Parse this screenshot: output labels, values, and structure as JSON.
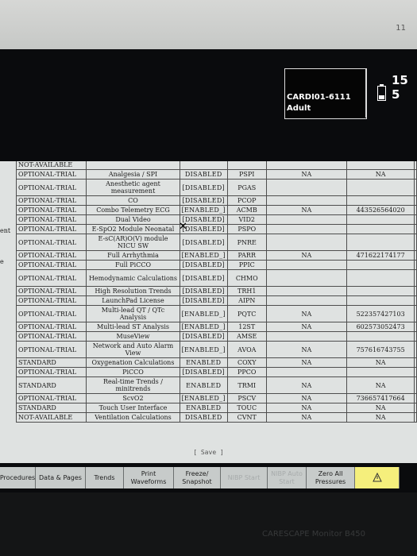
{
  "corner_label": "11",
  "patient": {
    "id": "CARDI01-6111",
    "type": "Adult"
  },
  "status_value": "15 5",
  "leftcut": {
    "a": "ent",
    "b": "e"
  },
  "rows": [
    {
      "option": "OPTIONAL-TRIAL",
      "feature": "Analgesia / SPI",
      "state": "DISABLED",
      "code": "PSPI",
      "c5": "NA",
      "c6": "NA"
    },
    {
      "option": "OPTIONAL-TRIAL",
      "feature": "Anesthetic agent measurement",
      "state": "[DISABLED]",
      "code": "PGAS",
      "c5": "",
      "c6": ""
    },
    {
      "option": "OPTIONAL-TRIAL",
      "feature": "CO",
      "state": "[DISABLED]",
      "code": "PCOP",
      "c5": "",
      "c6": ""
    },
    {
      "option": "OPTIONAL-TRIAL",
      "feature": "Combo Telemetry ECG",
      "state": "[ENABLED_]",
      "code": "ACMB",
      "c5": "NA",
      "c6": "443526564020"
    },
    {
      "option": "OPTIONAL-TRIAL",
      "feature": "Dual Video",
      "state": "[DISABLED]",
      "code": "VID2",
      "c5": "",
      "c6": ""
    },
    {
      "option": "OPTIONAL-TRIAL",
      "feature": "E-SpO2 Module Neonatal",
      "state": "[DISABLED]",
      "code": "PSPO",
      "c5": "",
      "c6": ""
    },
    {
      "option": "OPTIONAL-TRIAL",
      "feature": "E-sC(AR)O(V) module NICU SW",
      "state": "[DISABLED]",
      "code": "PNRE",
      "c5": "",
      "c6": ""
    },
    {
      "option": "OPTIONAL-TRIAL",
      "feature": "Full Arrhythmia",
      "state": "[ENABLED_]",
      "code": "PARR",
      "c5": "NA",
      "c6": "471622174177"
    },
    {
      "option": "OPTIONAL-TRIAL",
      "feature": "Full PiCCO",
      "state": "[DISABLED]",
      "code": "PPIC",
      "c5": "",
      "c6": ""
    },
    {
      "option": "OPTIONAL-TRIAL",
      "feature": "Hemodynamic Calculations",
      "state": "[DISABLED]",
      "code": "CHMO",
      "c5": "",
      "c6": ""
    },
    {
      "option": "OPTIONAL-TRIAL",
      "feature": "High Resolution Trends",
      "state": "[DISABLED]",
      "code": "TRH1",
      "c5": "",
      "c6": ""
    },
    {
      "option": "OPTIONAL-TRIAL",
      "feature": "LaunchPad License",
      "state": "[DISABLED]",
      "code": "AIPN",
      "c5": "",
      "c6": ""
    },
    {
      "option": "OPTIONAL-TRIAL",
      "feature": "Multi-lead QT / QTc Analysis",
      "state": "[ENABLED_]",
      "code": "PQTC",
      "c5": "NA",
      "c6": "522357427103"
    },
    {
      "option": "OPTIONAL-TRIAL",
      "feature": "Multi-lead ST Analysis",
      "state": "[ENABLED_]",
      "code": "12ST",
      "c5": "NA",
      "c6": "602573052473"
    },
    {
      "option": "OPTIONAL-TRIAL",
      "feature": "MuseView",
      "state": "[DISABLED]",
      "code": "AMSE",
      "c5": "",
      "c6": ""
    },
    {
      "option": "OPTIONAL-TRIAL",
      "feature": "Network and Auto Alarm View",
      "state": "[ENABLED_]",
      "code": "AVOA",
      "c5": "NA",
      "c6": "757616743755"
    },
    {
      "option": "STANDARD",
      "feature": "Oxygenation Calculations",
      "state": "ENABLED",
      "code": "COXY",
      "c5": "NA",
      "c6": "NA"
    },
    {
      "option": "OPTIONAL-TRIAL",
      "feature": "PiCCO",
      "state": "[DISABLED]",
      "code": "PPCO",
      "c5": "",
      "c6": ""
    },
    {
      "option": "STANDARD",
      "feature": "Real-time Trends / minitrends",
      "state": "ENABLED",
      "code": "TRMI",
      "c5": "NA",
      "c6": "NA"
    },
    {
      "option": "OPTIONAL-TRIAL",
      "feature": "ScvO2",
      "state": "[ENABLED_]",
      "code": "PSCV",
      "c5": "NA",
      "c6": "736657417664"
    },
    {
      "option": "STANDARD",
      "feature": "Touch User Interface",
      "state": "ENABLED",
      "code": "TOUC",
      "c5": "NA",
      "c6": "NA"
    },
    {
      "option": "NOT-AVAILABLE",
      "feature": "Ventilation Calculations",
      "state": "DISABLED",
      "code": "CVNT",
      "c5": "NA",
      "c6": "NA"
    }
  ],
  "top_row": {
    "option": "NOT-AVAILABLE"
  },
  "save_label": "[ Save ]",
  "menu": {
    "procedures": "Procedures",
    "data_pages": "Data & Pages",
    "trends": "Trends",
    "print": "Print Waveforms",
    "freeze": "Freeze/ Snapshot",
    "dim1": "NIBP Start",
    "dim2": "NIBP Auto Start",
    "zero": "Zero All Pressures",
    "alarm_icon": "alarm-bell-icon"
  },
  "brand": "CARESCAPE Monitor B450"
}
